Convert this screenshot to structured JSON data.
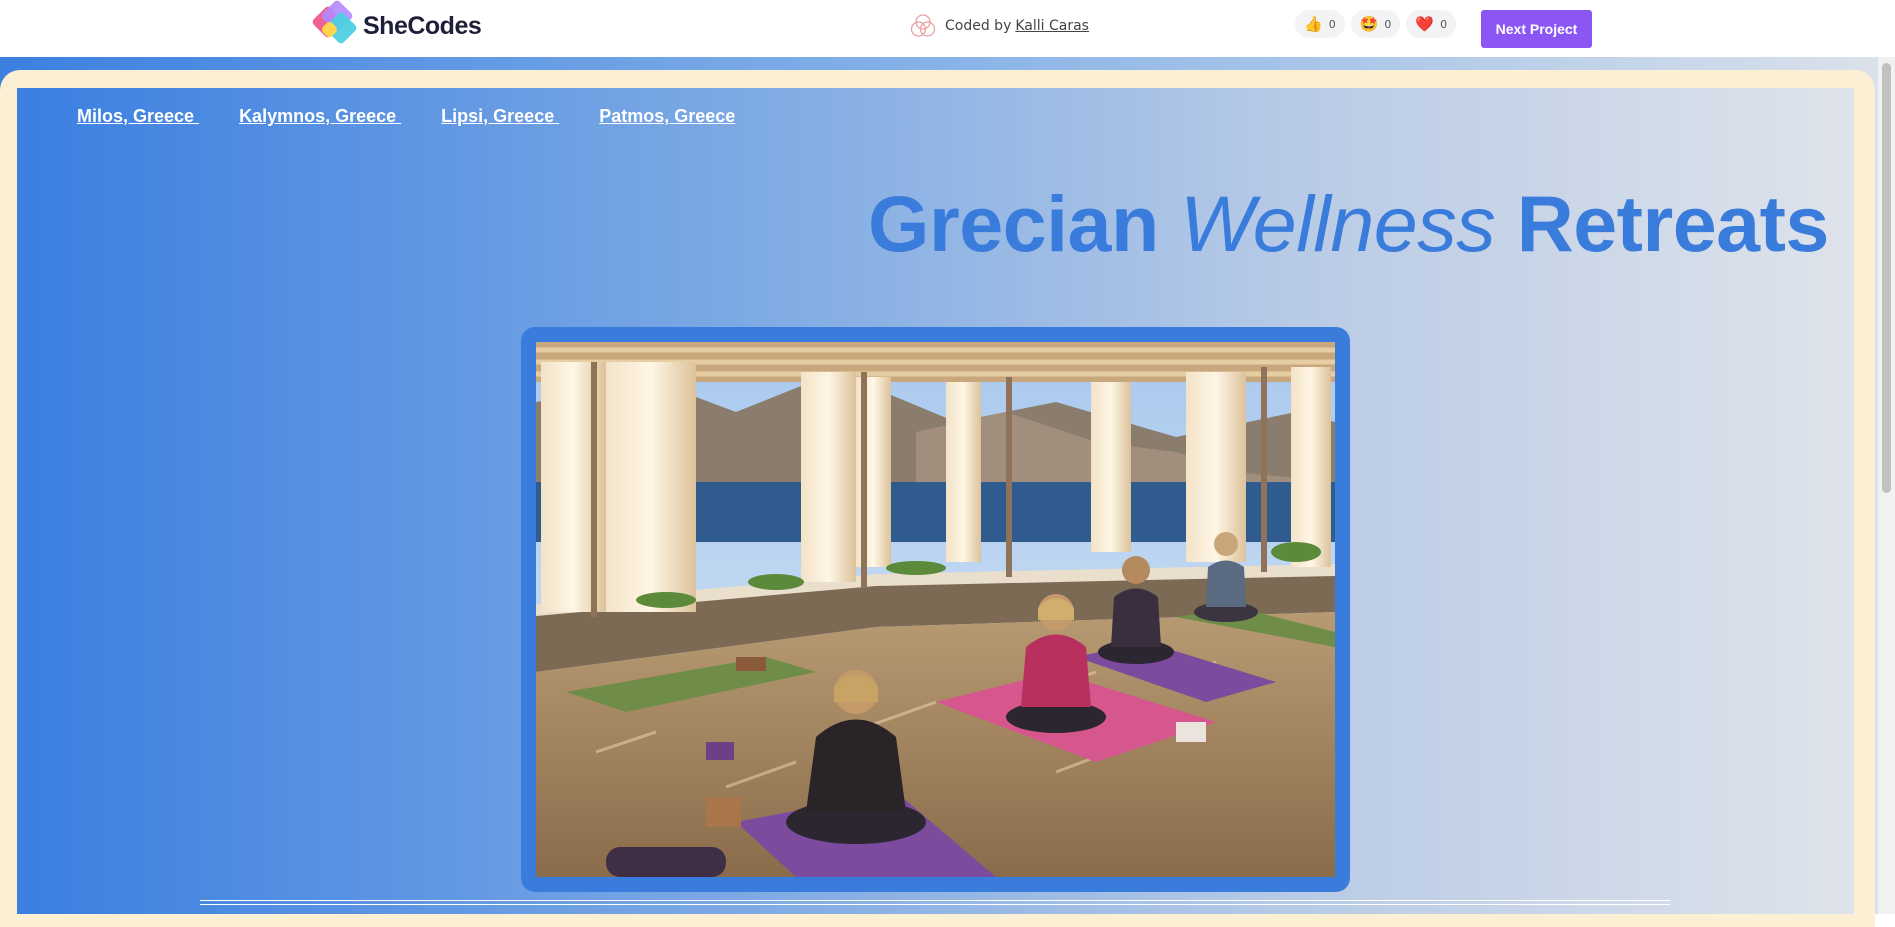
{
  "topbar": {
    "brand": "SheCodes",
    "credit_prefix": "Coded by",
    "credit_author": "Kalli Caras",
    "reactions": [
      {
        "icon": "thumbs-up-icon",
        "emoji": "👍",
        "count": "0"
      },
      {
        "icon": "star-struck-icon",
        "emoji": "🤩",
        "count": "0"
      },
      {
        "icon": "heart-icon",
        "emoji": "❤️",
        "count": "0"
      }
    ],
    "next_button": "Next Project",
    "accent_color": "#8c56f4"
  },
  "nav": {
    "links": [
      "Milos, Greece ",
      "Kalymnos, Greece ",
      "Lipsi, Greece ",
      "Patmos, Greece"
    ]
  },
  "hero": {
    "title_part1": "Grecian",
    "title_italic": "Wellness",
    "title_part2": "Retreats",
    "title_color": "#3a7cdb"
  },
  "photo": {
    "subject": "yoga class on a shaded terrace overlooking the sea"
  }
}
